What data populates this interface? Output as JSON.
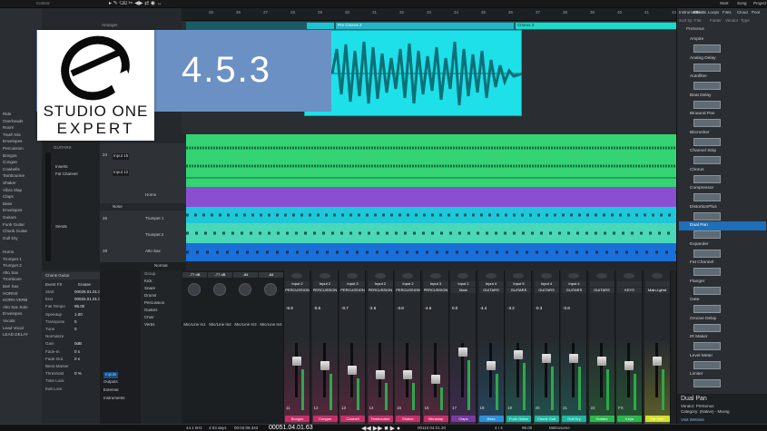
{
  "overlay": {
    "version": "4.5.3",
    "brand_line1": "STUDIO ONE",
    "brand_line2": "EXPERT"
  },
  "topbar": {
    "labels": [
      "Control",
      "Start",
      "Song",
      "Project"
    ]
  },
  "left_tracks": [
    "Group",
    "Kick",
    "Snare",
    "Drums",
    "Percussion",
    "",
    "",
    "Snare Bottom",
    "Hats",
    "Envelopes",
    "Tom 1",
    "Tom 2",
    "Ride",
    "Overheads",
    "Room",
    "Trash Mic",
    "Envelopes",
    "Percussion",
    "Bongos",
    "Congas",
    "Cowbells",
    "Tambourine",
    "Shaker",
    "Vibra Slap",
    "Claps",
    "Bass",
    "Envelopes",
    "Guitars",
    "Funk Guitar",
    "Chunk Guitar",
    "Gull Dry",
    "",
    "Horns",
    "Trumpet 1",
    "Trumpet 2",
    "Alto Sax",
    "Trombone",
    "Bari Sax",
    "HORNS",
    "HORN VERB",
    "Alto Sax Solo",
    "Envelopes",
    "Vocals",
    "Lead Vocal",
    "LEAD DELAY"
  ],
  "arranger": {
    "label": "Arranger",
    "sections": [
      "Pre Chorus",
      "Pre Chorus 2",
      "Chorus 3"
    ],
    "clip_label": "Chunk Guitar",
    "ruler_marks": [
      "25",
      "26",
      "27",
      "28",
      "29",
      "30",
      "31",
      "32",
      "33",
      "34",
      "35",
      "36",
      "37",
      "38",
      "39",
      "40",
      "41",
      "42"
    ]
  },
  "track_headers": [
    {
      "num": "",
      "name": "None"
    },
    {
      "num": "24",
      "name": "Input 15"
    },
    {
      "num": "",
      "name": "Input 12"
    },
    {
      "num": "",
      "name": "Horns"
    },
    {
      "num": "",
      "name": "None"
    },
    {
      "num": "26",
      "name": "Trumpet 1"
    },
    {
      "num": "",
      "name": "Trumpet 2"
    },
    {
      "num": "28",
      "name": "Alto Sax"
    },
    {
      "num": "",
      "name": "Normal"
    }
  ],
  "inspector": {
    "title": "Chunk Gullar",
    "row1": "Input L",
    "row2": "GUITARS",
    "row3": "Inserts",
    "row4": "Fat Channel",
    "sends": "Sends",
    "event_title": "Chunk Guitar",
    "event_fx": "Event FX",
    "enable": "Enable",
    "fields": [
      {
        "label": "Start",
        "value": "00026.01.01.00"
      },
      {
        "label": "End",
        "value": "00034.01.01.00"
      },
      {
        "label": "File Tempo",
        "value": "95.00"
      },
      {
        "label": "Speedup",
        "value": "1.00"
      },
      {
        "label": "Transpose",
        "value": "0"
      },
      {
        "label": "Tune",
        "value": "0"
      },
      {
        "label": "Normalize",
        "value": ""
      },
      {
        "label": "Gain",
        "value": "0dB"
      },
      {
        "label": "Fade-In",
        "value": "0 s"
      },
      {
        "label": "Fade-Out",
        "value": "0 s"
      },
      {
        "label": "Bend Marker",
        "value": ""
      },
      {
        "label": "Threshold",
        "value": "0 %"
      },
      {
        "label": "Time Lock",
        "value": ""
      },
      {
        "label": "Edit Lock",
        "value": ""
      }
    ]
  },
  "mixer": {
    "left_panel": [
      "Inputs",
      "Outputs",
      "External",
      "Instruments"
    ],
    "group_title": "Group",
    "groups": [
      "Kick",
      "Snare",
      "Drums",
      "Percussion",
      "Guitars",
      "Choir",
      "Verbs"
    ],
    "input_strips": [
      {
        "top": "-77 dB",
        "name": "Mic/Line In1"
      },
      {
        "top": "-77 dB",
        "name": "Mic/Line In2"
      },
      {
        "top": "-84",
        "name": "Mic/Line In3"
      },
      {
        "top": "-84",
        "name": "Mic/Line In4"
      }
    ],
    "channels": [
      {
        "head": "Input 2",
        "sub": "PERCUSSION",
        "vol": "-5.9",
        "num": "11",
        "name": "Bongos",
        "color": "#c2306a"
      },
      {
        "head": "Input 2",
        "sub": "PERCUSSION",
        "vol": "-5.5",
        "num": "12",
        "name": "Congas",
        "color": "#c2306a"
      },
      {
        "head": "Input 3",
        "sub": "PERCUSSION",
        "vol": "-0.7",
        "num": "13",
        "name": "Cowbell",
        "color": "#c2306a"
      },
      {
        "head": "Input 2",
        "sub": "PERCUSSION",
        "vol": "-2.6",
        "num": "14",
        "name": "Tambourine",
        "color": "#c2306a"
      },
      {
        "head": "Input 2",
        "sub": "PERCUSSION",
        "vol": "-3.8",
        "num": "15",
        "name": "Shaker",
        "color": "#c2306a"
      },
      {
        "head": "Input 3",
        "sub": "PERCUSSION",
        "vol": "-4.6",
        "num": "16",
        "name": "Vibraslap",
        "color": "#c2306a"
      },
      {
        "head": "Input 1",
        "sub": "Main",
        "vol": "0.0",
        "num": "17",
        "name": "Claps",
        "color": "#7a3aa0"
      },
      {
        "head": "Input 4",
        "sub": "GUITARS",
        "vol": "-4.4",
        "num": "18",
        "name": "Bass",
        "color": "#2f8fd8"
      },
      {
        "head": "Input 5",
        "sub": "GUITARS",
        "vol": "-3.2",
        "num": "19",
        "name": "Funk Guitar",
        "color": "#22b5a0"
      },
      {
        "head": "Input 4",
        "sub": "GUITARS",
        "vol": "-0.3",
        "num": "20",
        "name": "Chunk Guit",
        "color": "#22b5a0"
      },
      {
        "head": "Input 4",
        "sub": "GUITARS",
        "vol": "-0.8",
        "num": "21",
        "name": "Gull Dry",
        "color": "#22b5a0"
      },
      {
        "head": "",
        "sub": "GUITARS",
        "vol": "",
        "num": "22",
        "name": "Guitars",
        "color": "#2fb54f"
      },
      {
        "head": "",
        "sub": "KEYS",
        "vol": "",
        "num": "FX",
        "name": "Keys",
        "color": "#2fb54f"
      },
      {
        "head": "",
        "sub": "Main-Lghtd",
        "vol": "",
        "num": "",
        "name": "Fat Verb",
        "color": "#d6e030"
      }
    ]
  },
  "browser": {
    "tabs": [
      "Instruments",
      "Effects",
      "Loops",
      "Files",
      "Cloud",
      "Pool"
    ],
    "sort_labels": [
      "Sort by:",
      "Flat",
      "Folder",
      "Vendor",
      "Type"
    ],
    "category": "PreSonus",
    "items": [
      "Ampire",
      "Analog Delay",
      "Autofilter",
      "Beat Delay",
      "Binaural Pan",
      "Bitcrusher",
      "Channel Strip",
      "Chorus",
      "Compressor",
      "DistortionPlus",
      "Dual Pan",
      "Expander",
      "Fat Channel",
      "Flanger",
      "Gate",
      "Groove Delay",
      "IR Maker",
      "Level Meter",
      "Limiter"
    ],
    "selected": "Dual Pan",
    "footer_title": "Dual Pan",
    "footer_vendor": "Vendor: PreSonus",
    "footer_category": "Category: (Native) - Mixing",
    "footer_link": "Visit Website"
  },
  "transport": {
    "sample_rate": "44.1 kHz",
    "days": "4:03 days",
    "time": "00:02:08.342",
    "position": "00051.04.01.63",
    "loop": "00110.04.01.20",
    "timesig": "4 / 4",
    "tempo": "95.00",
    "metronome": "Metronome"
  },
  "colors": {
    "cyan_clip": "#1ee0e8",
    "green_lane": "#34d474",
    "purple_lane": "#8a4fd0",
    "blue_lane": "#1a6fd8",
    "overlay_blue": "#6b90c4"
  }
}
